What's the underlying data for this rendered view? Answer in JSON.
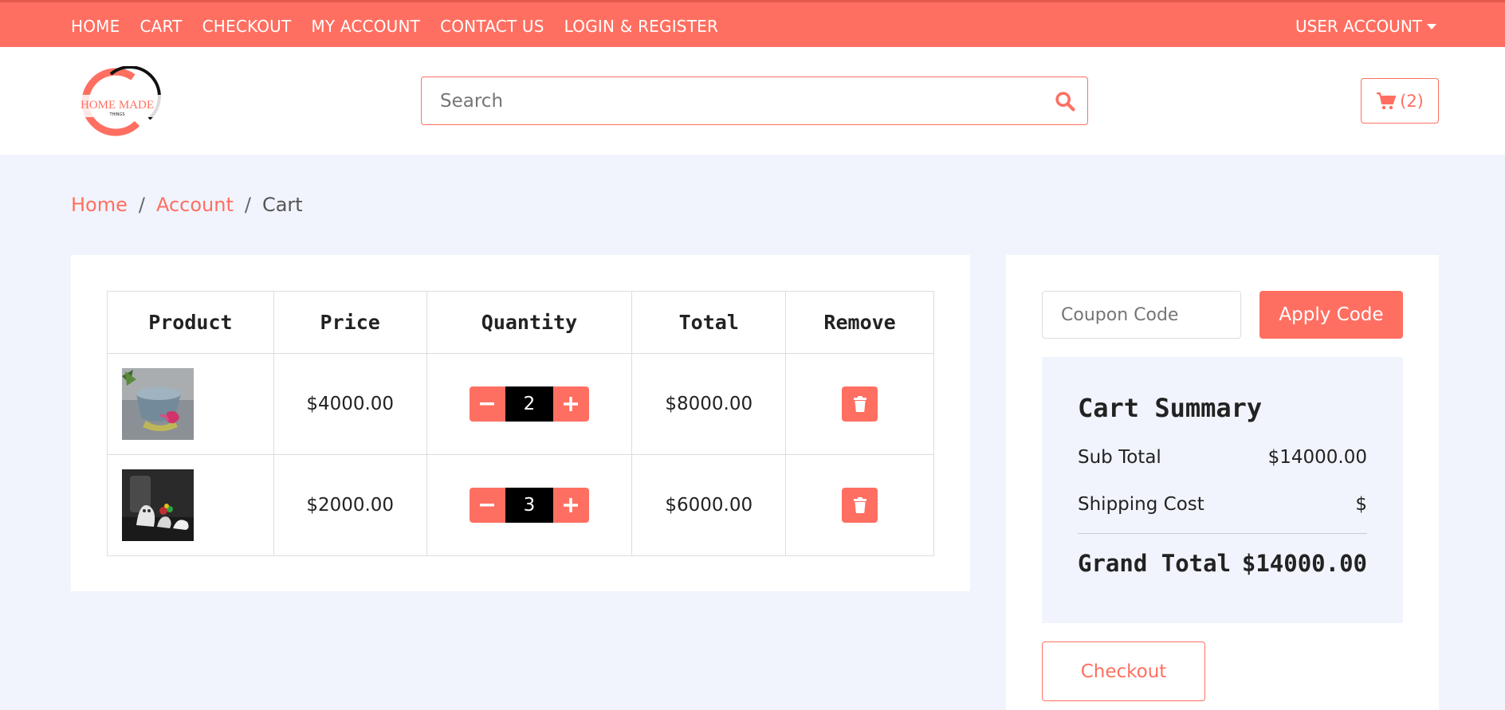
{
  "topnav": {
    "items": [
      "HOME",
      "CART",
      "CHECKOUT",
      "MY ACCOUNT",
      "CONTACT US",
      "LOGIN & REGISTER"
    ],
    "user_account": "USER ACCOUNT"
  },
  "header": {
    "logo_text": "HOME MADE",
    "logo_sub": "THINGS",
    "search_placeholder": "Search",
    "cart_count": "(2)"
  },
  "breadcrumb": {
    "home": "Home",
    "account": "Account",
    "current": "Cart",
    "sep": "/"
  },
  "cart_table": {
    "headers": [
      "Product",
      "Price",
      "Quantity",
      "Total",
      "Remove"
    ],
    "rows": [
      {
        "price": "$4000.00",
        "quantity": "2",
        "total": "$8000.00"
      },
      {
        "price": "$2000.00",
        "quantity": "3",
        "total": "$6000.00"
      }
    ]
  },
  "coupon": {
    "placeholder": "Coupon Code",
    "apply_label": "Apply Code"
  },
  "summary": {
    "title": "Cart Summary",
    "subtotal_label": "Sub Total",
    "subtotal_value": "$14000.00",
    "shipping_label": "Shipping Cost",
    "shipping_value": "$",
    "grand_label": "Grand Total",
    "grand_value": "$14000.00"
  },
  "checkout_label": "Checkout",
  "colors": {
    "accent": "#ff6f61",
    "background": "#f1f4fd"
  }
}
